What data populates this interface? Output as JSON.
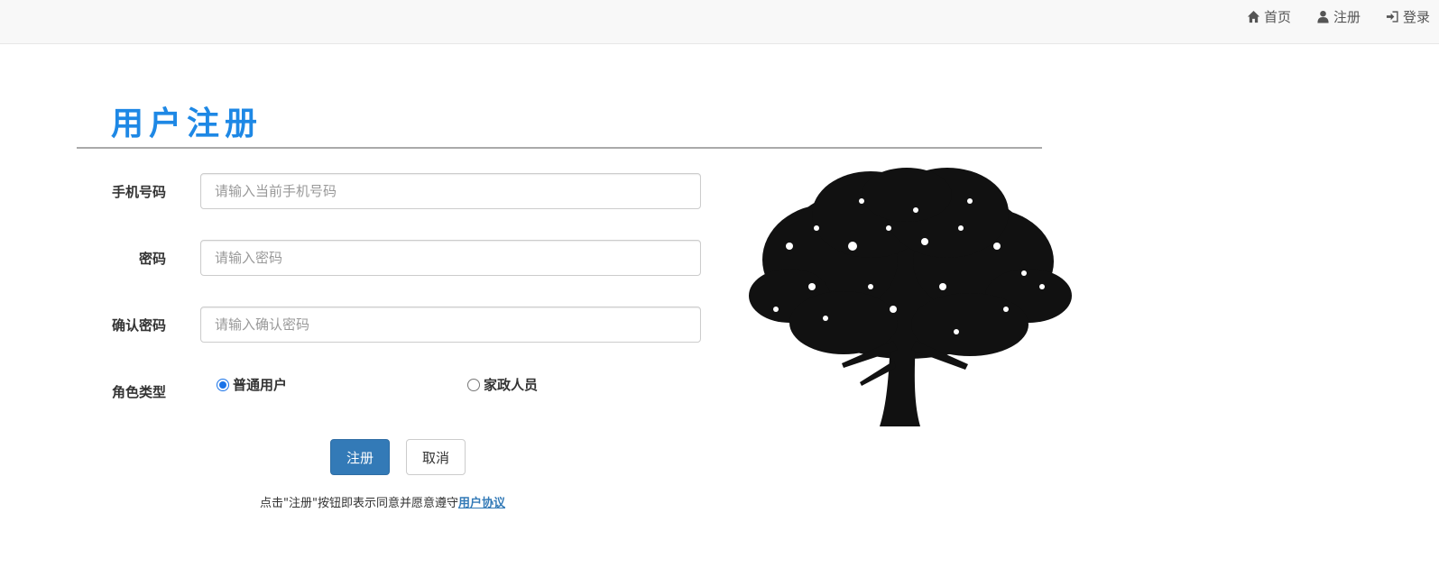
{
  "nav": {
    "home": {
      "label": "首页",
      "icon": "home-icon"
    },
    "register": {
      "label": "注册",
      "icon": "user-icon"
    },
    "login": {
      "label": "登录",
      "icon": "log-in-icon"
    }
  },
  "page": {
    "title": "用户注册"
  },
  "form": {
    "phone": {
      "label": "手机号码",
      "placeholder": "请输入当前手机号码",
      "value": ""
    },
    "password": {
      "label": "密码",
      "placeholder": "请输入密码",
      "value": ""
    },
    "confirm_password": {
      "label": "确认密码",
      "placeholder": "请输入确认密码",
      "value": ""
    },
    "role": {
      "label": "角色类型",
      "options": [
        {
          "label": "普通用户",
          "checked": true
        },
        {
          "label": "家政人员",
          "checked": false
        }
      ]
    }
  },
  "buttons": {
    "register": "注册",
    "cancel": "取消"
  },
  "agreement": {
    "text": "点击\"注册\"按钮即表示同意并愿意遵守",
    "link": "用户协议"
  },
  "image": {
    "icon": "tree-silhouette-icon"
  },
  "colors": {
    "accent": "#1e88e5",
    "primary_button": "#337ab7"
  }
}
